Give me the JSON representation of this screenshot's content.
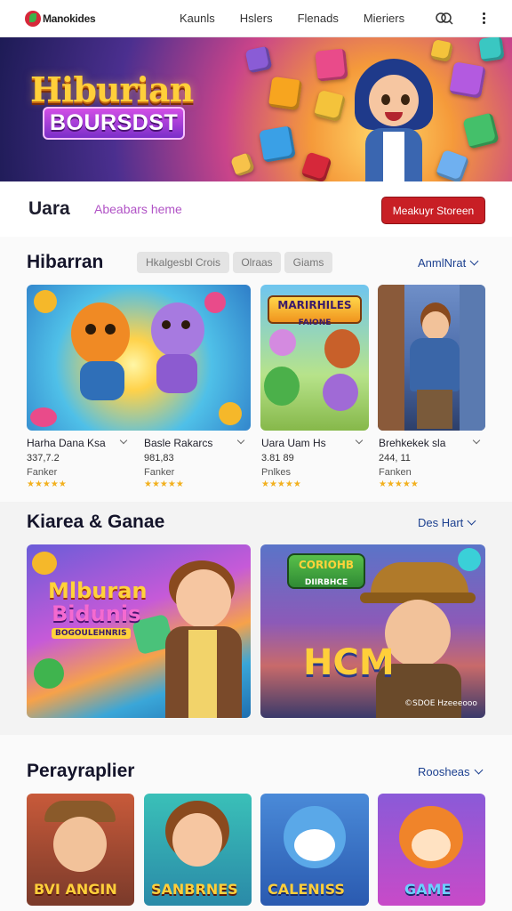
{
  "app": {
    "logo_text": "Manokides"
  },
  "nav": {
    "links": [
      "Kaunls",
      "Hslers",
      "Flenads",
      "Mieriers"
    ],
    "search_icon": "search-icon",
    "more_icon": "more-vertical-icon"
  },
  "hero": {
    "title": "Hiburian",
    "subtitle": "BOURSDST"
  },
  "section_bar": {
    "title": "Uara",
    "link": "Abeabars heme",
    "button": "Meakuyr Storeen",
    "button_color": "#c81f25"
  },
  "featured": {
    "title": "Hibarran",
    "chips": [
      "Hkalgesbl Crois",
      "Olraas",
      "Giams"
    ],
    "more": "AnmlNrat",
    "cards": [
      {
        "title": "Harha Dana Ksa",
        "number": "337,7.2",
        "publisher": "Fanker",
        "stars": "★★★★★"
      },
      {
        "title": "Basle Rakarcs",
        "number": "981,83",
        "publisher": "Fanker",
        "stars": "★★★★★"
      },
      {
        "title": "Uara Uam Hs",
        "number": "3.81 89",
        "publisher": "Pnlkes",
        "stars": "★★★★★"
      },
      {
        "title": "Brehkekek sla",
        "number": "244, 11",
        "publisher": "Fanken",
        "stars": "★★★★★"
      }
    ],
    "card2_art_title": "MARIRHILES",
    "card2_art_sub": "FAIONE"
  },
  "kiarea": {
    "title": "Kiarea & Ganae",
    "more": "Des Hart",
    "banner1_line1": "Mlburan",
    "banner1_line2": "Bidunis",
    "banner1_tag": "BOGOULEHNRIS",
    "banner2_title": "CORIOHB",
    "banner2_sub": "DIIRBHCE",
    "banner2_big": "HCM",
    "banner2_caption": "©SDOE Hzeeeooo"
  },
  "perayraplier": {
    "title": "Perayraplier",
    "more": "Roosheas",
    "tiles": [
      "BVI ANGIN",
      "SANBRNES",
      "CALENISS",
      "GAME"
    ]
  },
  "colors": {
    "accent": "#c81f25",
    "link_purple": "#b153c6",
    "link_blue": "#1b3f8f",
    "star": "#f2b01e"
  }
}
